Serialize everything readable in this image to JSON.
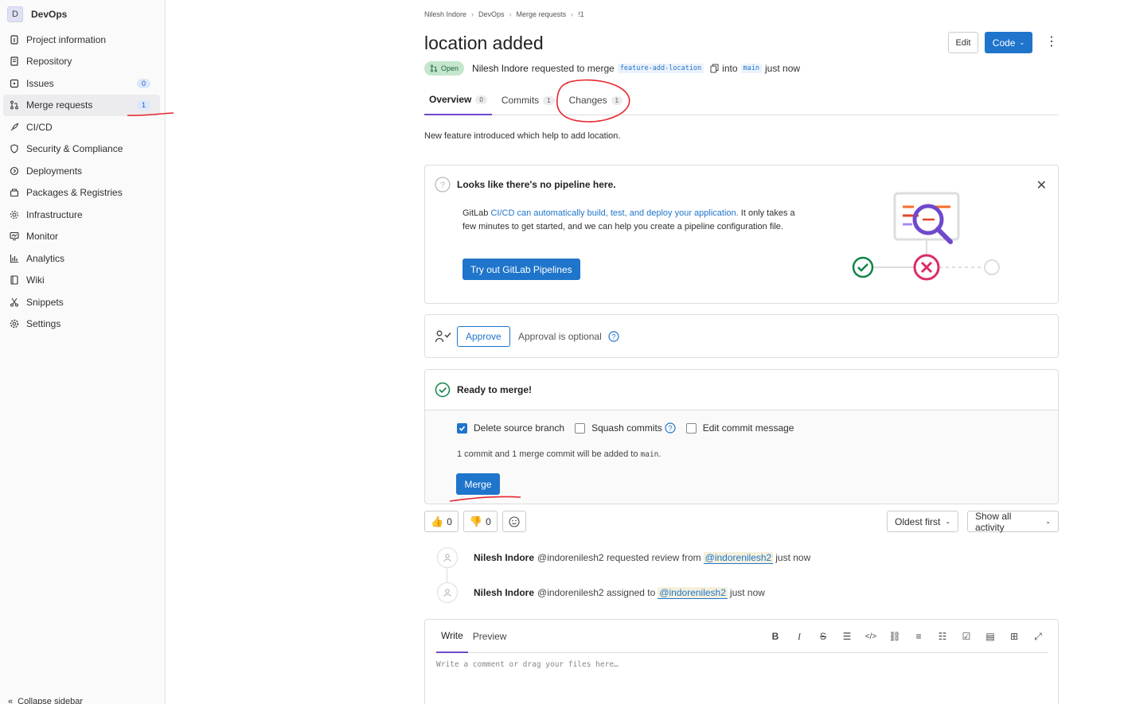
{
  "sidebar": {
    "project_initial": "D",
    "project_name": "DevOps",
    "items": [
      {
        "label": "Project information"
      },
      {
        "label": "Repository"
      },
      {
        "label": "Issues",
        "count": "0"
      },
      {
        "label": "Merge requests",
        "count": "1"
      },
      {
        "label": "CI/CD"
      },
      {
        "label": "Security & Compliance"
      },
      {
        "label": "Deployments"
      },
      {
        "label": "Packages & Registries"
      },
      {
        "label": "Infrastructure"
      },
      {
        "label": "Monitor"
      },
      {
        "label": "Analytics"
      },
      {
        "label": "Wiki"
      },
      {
        "label": "Snippets"
      },
      {
        "label": "Settings"
      }
    ],
    "collapse_label": "Collapse sidebar"
  },
  "breadcrumb": [
    "Nilesh Indore",
    "DevOps",
    "Merge requests",
    "!1"
  ],
  "mr": {
    "title": "location added",
    "edit_label": "Edit",
    "code_label": "Code",
    "status": "Open",
    "author": "Nilesh Indore",
    "requested_text": "requested to merge",
    "source_branch": "feature-add-location",
    "into_text": "into",
    "target_branch": "main",
    "time": "just now",
    "description": "New feature introduced which help to add location."
  },
  "tabs": [
    {
      "label": "Overview",
      "count": "0"
    },
    {
      "label": "Commits",
      "count": "1"
    },
    {
      "label": "Changes",
      "count": "1"
    }
  ],
  "pipeline": {
    "title": "Looks like there's no pipeline here.",
    "text_prefix": "GitLab",
    "text_link": "CI/CD can automatically build, test, and deploy your application.",
    "text_suffix": "It only takes a few minutes to get started, and we can help you create a pipeline configuration file.",
    "button": "Try out GitLab Pipelines"
  },
  "approval": {
    "button": "Approve",
    "text": "Approval is optional"
  },
  "merge": {
    "status": "Ready to merge!",
    "delete_source": "Delete source branch",
    "squash": "Squash commits",
    "edit_message": "Edit commit message",
    "note_prefix": "1 commit and 1 merge commit will be added to",
    "note_branch": "main",
    "note_suffix": ".",
    "button": "Merge"
  },
  "reactions": {
    "thumbs_up": "0",
    "thumbs_down": "0"
  },
  "sort": {
    "order": "Oldest first",
    "filter": "Show all activity"
  },
  "activity": [
    {
      "author": "Nilesh Indore",
      "handle": "@indorenilesh2",
      "action": "requested review from",
      "mention": "@indorenilesh2",
      "time": "just now"
    },
    {
      "author": "Nilesh Indore",
      "handle": "@indorenilesh2",
      "action": "assigned to",
      "mention": "@indorenilesh2",
      "time": "just now"
    }
  ],
  "comment": {
    "write_tab": "Write",
    "preview_tab": "Preview",
    "placeholder": "Write a comment or drag your files here…"
  },
  "colors": {
    "accent": "#1f75cb",
    "tab_active": "#6e49cb",
    "annotation": "#e8262e"
  }
}
